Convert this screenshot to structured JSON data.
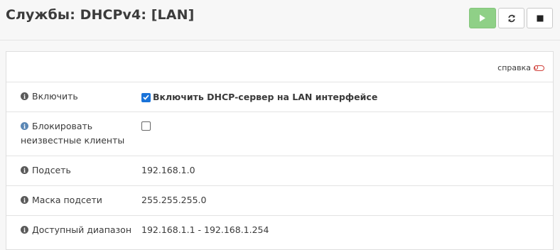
{
  "header": {
    "title": "Службы: DHCPv4: [LAN]",
    "buttons": {
      "start_icon": "play-icon",
      "restart_icon": "refresh-icon",
      "stop_icon": "stop-icon"
    }
  },
  "panel": {
    "help_label": "справка",
    "rows": [
      {
        "label": "Включить",
        "checkbox_checked": true,
        "value": "Включить DHCP-сервер на LAN интерфейсе"
      },
      {
        "label_line1": "Блокировать",
        "label_line2": "неизвестные клиенты",
        "checkbox_checked": false
      },
      {
        "label": "Подсеть",
        "value": "192.168.1.0"
      },
      {
        "label": "Маска подсети",
        "value": "255.255.255.0"
      },
      {
        "label": "Доступный диапазон",
        "value": "192.168.1.1 - 192.168.1.254"
      }
    ]
  },
  "colors": {
    "start_button": "#8fd087",
    "checkbox_checked": "#1a73d9",
    "help_toggle": "#d0403a",
    "info_icon_blue": "#5a87b5"
  }
}
